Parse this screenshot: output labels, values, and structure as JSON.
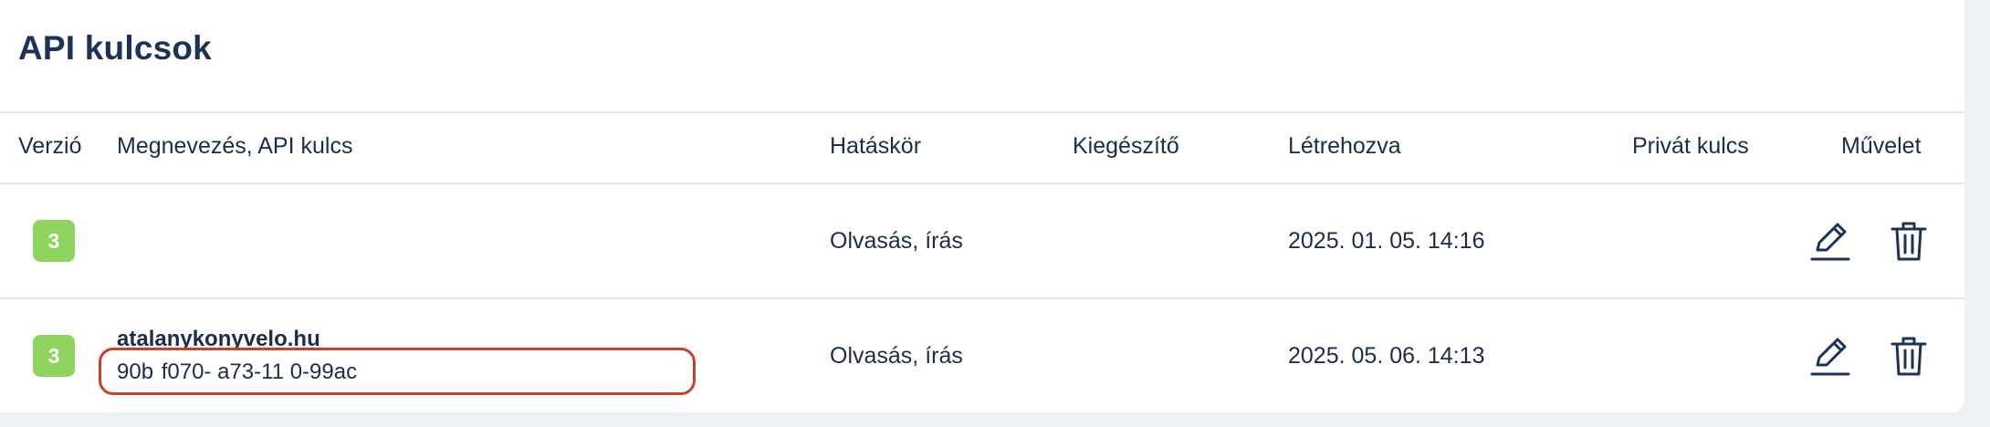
{
  "page": {
    "title": "API kulcsok"
  },
  "table": {
    "headers": {
      "version": "Verzió",
      "name_key": "Megnevezés, API kulcs",
      "scope": "Hatáskör",
      "extension": "Kiegészítő",
      "created": "Létrehozva",
      "private_key": "Privát kulcs",
      "action": "Művelet"
    },
    "rows": [
      {
        "version": "3",
        "name": "",
        "api_key": "",
        "scope": "Olvasás, írás",
        "extension": "",
        "created": "2025. 01. 05. 14:16",
        "private_key": ""
      },
      {
        "version": "3",
        "name": "atalanykonyvelo.hu",
        "api_key": "90b  f070-  a73-11 0-99ac",
        "scope": "Olvasás, írás",
        "extension": "",
        "created": "2025. 05. 06. 14:13",
        "private_key": ""
      }
    ]
  },
  "icons": {
    "edit": "pencil-icon",
    "delete": "trash-icon"
  },
  "colors": {
    "badge": "#8fd45f",
    "text": "#1b2d4a",
    "highlight_border": "#c9412b",
    "background": "#eef1f4"
  }
}
